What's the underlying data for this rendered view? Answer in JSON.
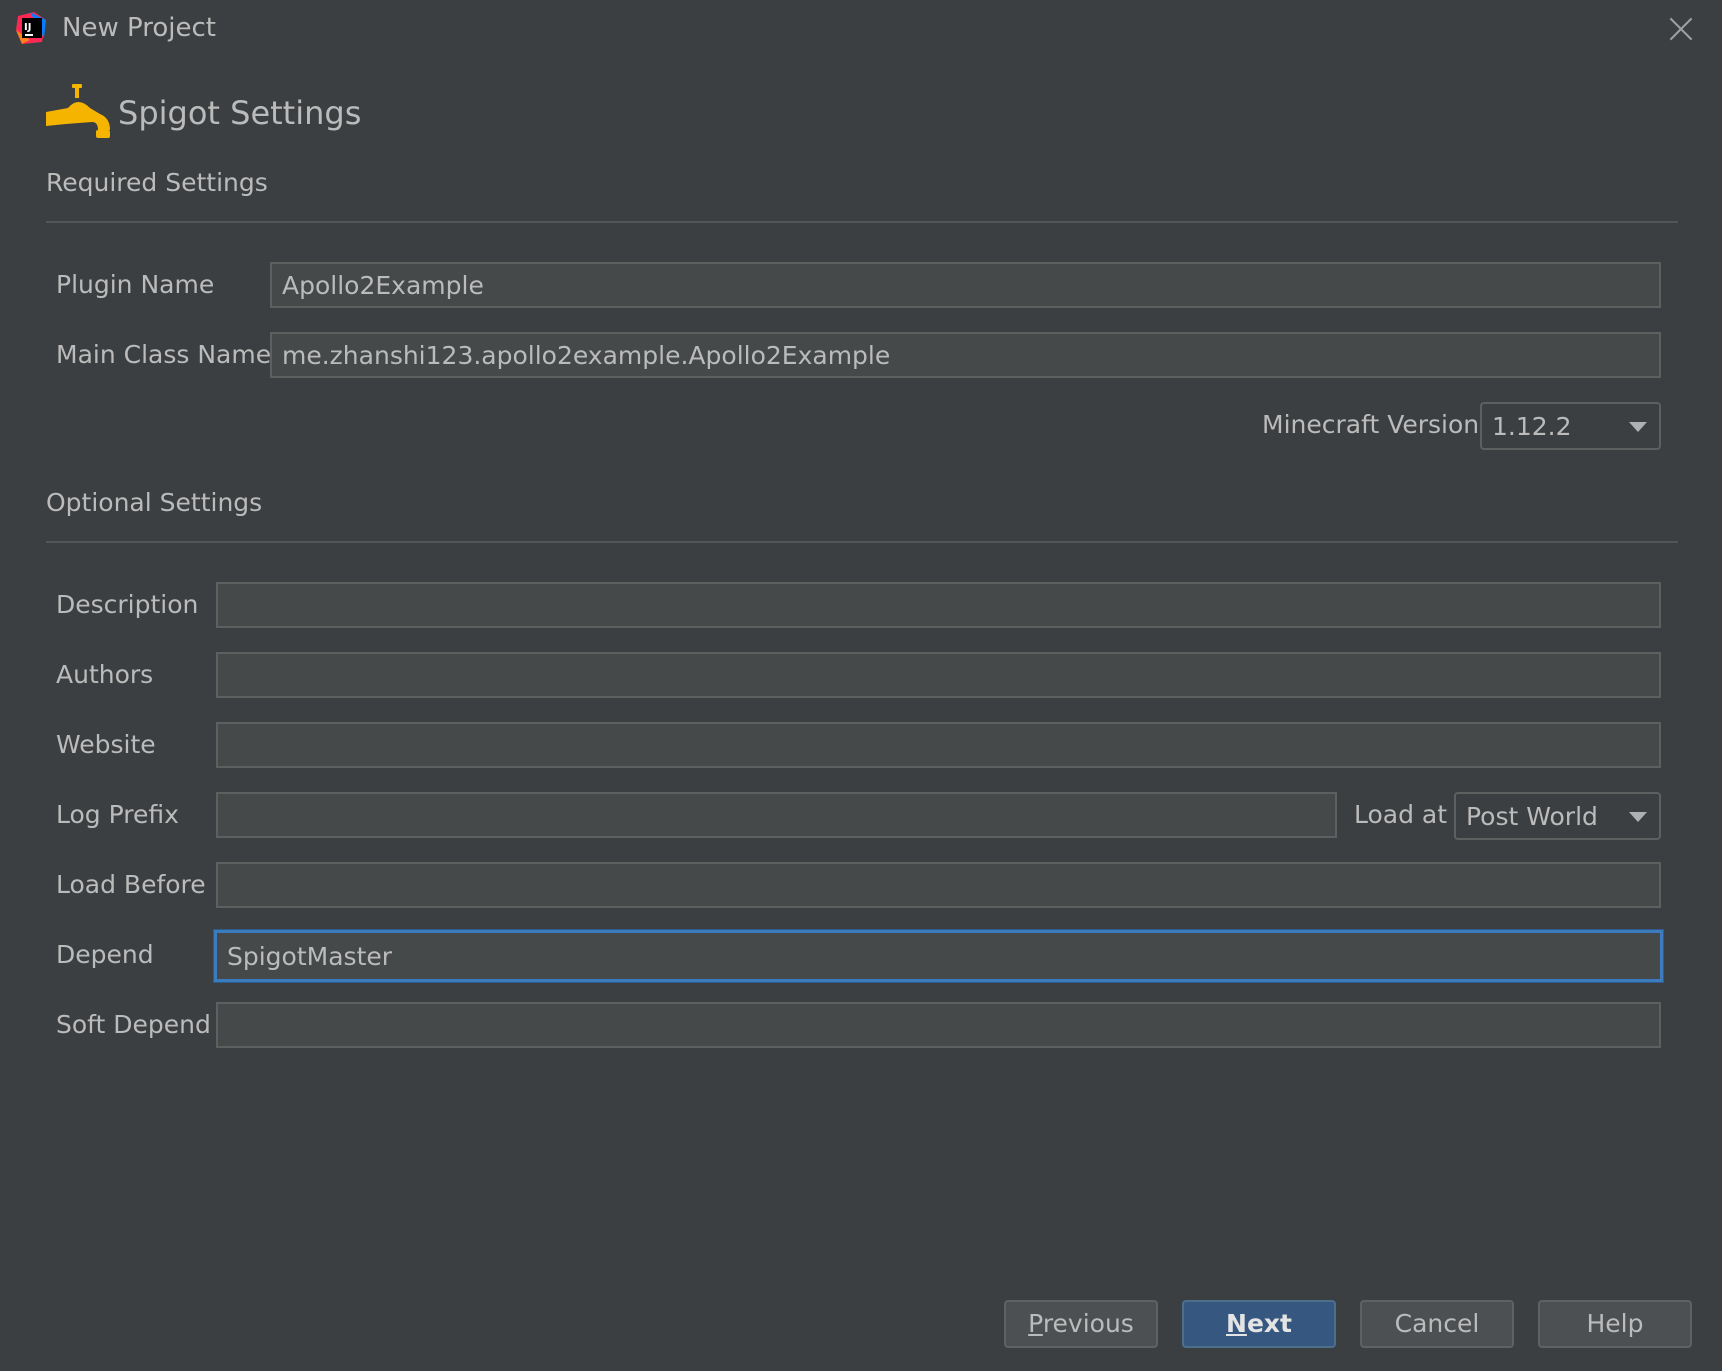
{
  "window": {
    "title": "New Project",
    "close_icon": "close-icon"
  },
  "header": {
    "title": "Spigot Settings",
    "icon": "spigot-faucet-icon",
    "icon_color": "#f4b400"
  },
  "required": {
    "section_title": "Required Settings",
    "plugin_name": {
      "label": "Plugin Name",
      "value": "Apollo2Example"
    },
    "main_class": {
      "label": "Main Class Name",
      "value": "me.zhanshi123.apollo2example.Apollo2Example"
    },
    "minecraft_version": {
      "label": "Minecraft Version",
      "value": "1.12.2"
    }
  },
  "optional": {
    "section_title": "Optional Settings",
    "description": {
      "label": "Description",
      "value": ""
    },
    "authors": {
      "label": "Authors",
      "value": ""
    },
    "website": {
      "label": "Website",
      "value": ""
    },
    "log_prefix": {
      "label": "Log Prefix",
      "value": ""
    },
    "load_at": {
      "label": "Load at",
      "value": "Post World"
    },
    "load_before": {
      "label": "Load Before",
      "value": ""
    },
    "depend": {
      "label": "Depend",
      "value": "SpigotMaster"
    },
    "soft_depend": {
      "label": "Soft Depend",
      "value": ""
    }
  },
  "buttons": {
    "previous": {
      "mnemonic": "P",
      "rest": "revious"
    },
    "next": {
      "mnemonic": "N",
      "rest": "ext"
    },
    "cancel": "Cancel",
    "help": "Help"
  },
  "colors": {
    "background": "#3c3f41",
    "field": "#45494a",
    "focus": "#3d7bbf",
    "primary_button": "#365880"
  }
}
